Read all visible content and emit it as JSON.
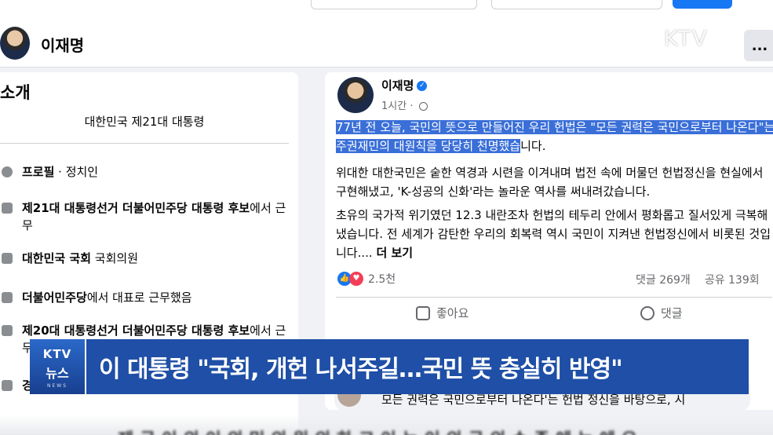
{
  "header": {
    "profile_name": "이재명",
    "broadcaster_logo": "KTV",
    "more_label": "..."
  },
  "intro": {
    "title": "소개",
    "bio": "대한민국 제21대 대통령",
    "items": [
      {
        "icon": "info-icon",
        "bold": "프로필",
        "rest": " · 정치인"
      },
      {
        "icon": "briefcase-icon",
        "bold": "제21대 대통령선거 더불어민주당 대통령 후보",
        "rest": "에서 근무"
      },
      {
        "icon": "briefcase-icon",
        "bold": "대한민국 국회",
        "rest": " 국회의원"
      },
      {
        "icon": "briefcase-icon",
        "bold": "더불어민주당",
        "rest": "에서 대표로 근무했음"
      },
      {
        "icon": "briefcase-icon",
        "bold": "제20대 대통령선거 더불어민주당 대통령 후보",
        "rest": "에서 근무"
      },
      {
        "icon": "briefcase-icon",
        "bold": "경",
        "rest": ""
      }
    ]
  },
  "post": {
    "author": "이재명",
    "time": "1시간",
    "paragraph1_highlight": "77년 전 오늘, 국민의 뜻으로 만들어진 우리 헌법은 \"모든 권력은 국민으로부터 나온다\"는 주권재민의 대원칙을 당당히 천명했습",
    "paragraph1_rest": "니다.",
    "paragraph2": "위대한 대한국민은 숱한 역경과 시련을 이겨내며 법전 속에 머물던 헌법정신을 현실에서 구현해냈고, 'K-성공의 신화'라는 놀라운 역사를 써내려갔습니다.",
    "paragraph3": "초유의 국가적 위기였던 12.3 내란조차 헌법의 테두리 안에서 평화롭고 질서있게 극복해냈습니다. 전 세계가 감탄한 우리의 회복력 역시 국민이 지켜낸 헌법정신에서 비롯된 것입니다.... ",
    "see_more": "더 보기",
    "reactions_count": "2.5천",
    "comments_count": "댓글 269개",
    "shares_count": "공유 139회",
    "like_label": "좋아요",
    "comment_label": "댓글"
  },
  "comment_preview": {
    "text": "모든 권력은 국민으로부터 나온다'는 헌법 정신을 바탕으로, 시"
  },
  "caption": {
    "badge_line1": "KTV",
    "badge_line2": "뉴스",
    "badge_line3": "NEWS",
    "headline": "이 대통령 \"국회, 개헌 나서주길…국민 뜻 충실히 반영\""
  },
  "bottom_subtitle": "제 국 이 의 이 의 민 의 원 의 하 고 이 는 이 의 국 의 수 준 에 는 에 요"
}
